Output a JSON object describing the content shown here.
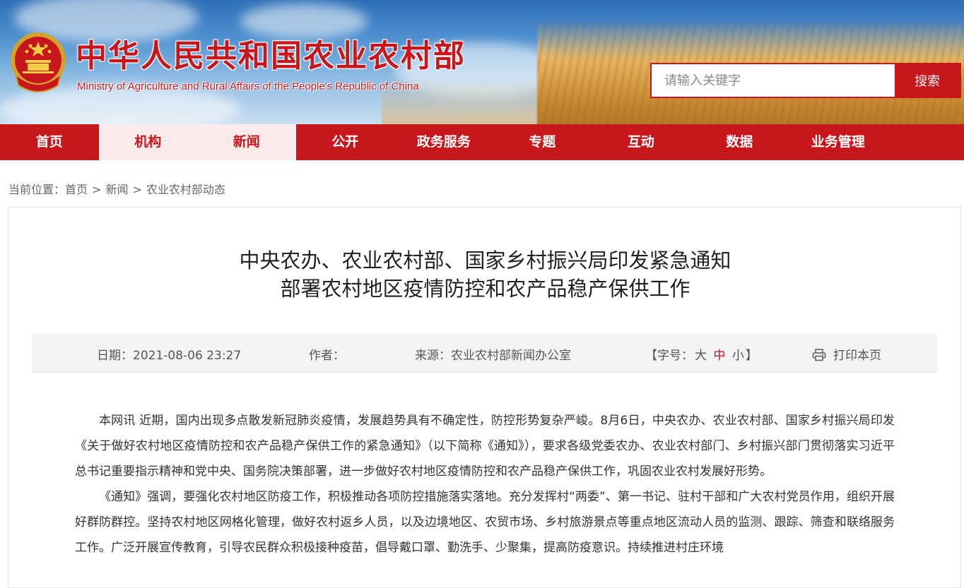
{
  "header": {
    "title": "中华人民共和国农业农村部",
    "subtitle": "Ministry of Agriculture and Rural Affairs of the People's Republic of China",
    "emblem_icon": "national-emblem-icon",
    "search": {
      "placeholder": "请输入关键字",
      "button_label": "搜索"
    }
  },
  "colors": {
    "brand_red": "#c8161d",
    "nav_active_bg": "#fbeaea",
    "meta_bg": "#f3f3f3"
  },
  "nav": {
    "items": [
      {
        "label": "首页"
      },
      {
        "label": "机构"
      },
      {
        "label": "新闻"
      },
      {
        "label": "公开"
      },
      {
        "label": "政务服务"
      },
      {
        "label": "专题"
      },
      {
        "label": "互动"
      },
      {
        "label": "数据"
      },
      {
        "label": "业务管理"
      }
    ],
    "highlighted": [
      "机构",
      "新闻"
    ]
  },
  "breadcrumb": {
    "prefix": "当前位置：",
    "items": [
      "首页",
      "新闻",
      "农业农村部动态"
    ],
    "separator": ">"
  },
  "article": {
    "title_line1": "中央农办、农业农村部、国家乡村振兴局印发紧急通知",
    "title_line2": "部署农村地区疫情防控和农产品稳产保供工作",
    "meta": {
      "date_label": "日期：",
      "date": "2021-08-06 23:27",
      "author_label": "作者：",
      "author": "",
      "source_label": "来源：",
      "source": "农业农村部新闻办公室",
      "font_size_open": "【字号：",
      "font_size_large": "大",
      "font_size_medium": "中",
      "font_size_small": "小",
      "font_size_close": "】",
      "print_icon": "printer-icon",
      "print_label": "打印本页"
    },
    "paragraphs": [
      "本网讯 近期，国内出现多点散发新冠肺炎疫情，发展趋势具有不确定性，防控形势复杂严峻。8月6日，中央农办、农业农村部、国家乡村振兴局印发《关于做好农村地区疫情防控和农产品稳产保供工作的紧急通知》（以下简称《通知》），要求各级党委农办、农业农村部门、乡村振兴部门贯彻落实习近平总书记重要指示精神和党中央、国务院决策部署，进一步做好农村地区疫情防控和农产品稳产保供工作，巩固农业农村发展好形势。",
      "《通知》强调，要强化农村地区防疫工作，积极推动各项防控措施落实落地。充分发挥村“两委”、第一书记、驻村干部和广大农村党员作用，组织开展好群防群控。坚持农村地区网格化管理，做好农村返乡人员，以及边境地区、农贸市场、乡村旅游景点等重点地区流动人员的监测、跟踪、筛查和联络服务工作。广泛开展宣传教育，引导农民群众积极接种疫苗，倡导戴口罩、勤洗手、少聚集，提高防疫意识。持续推进村庄环境"
    ]
  }
}
